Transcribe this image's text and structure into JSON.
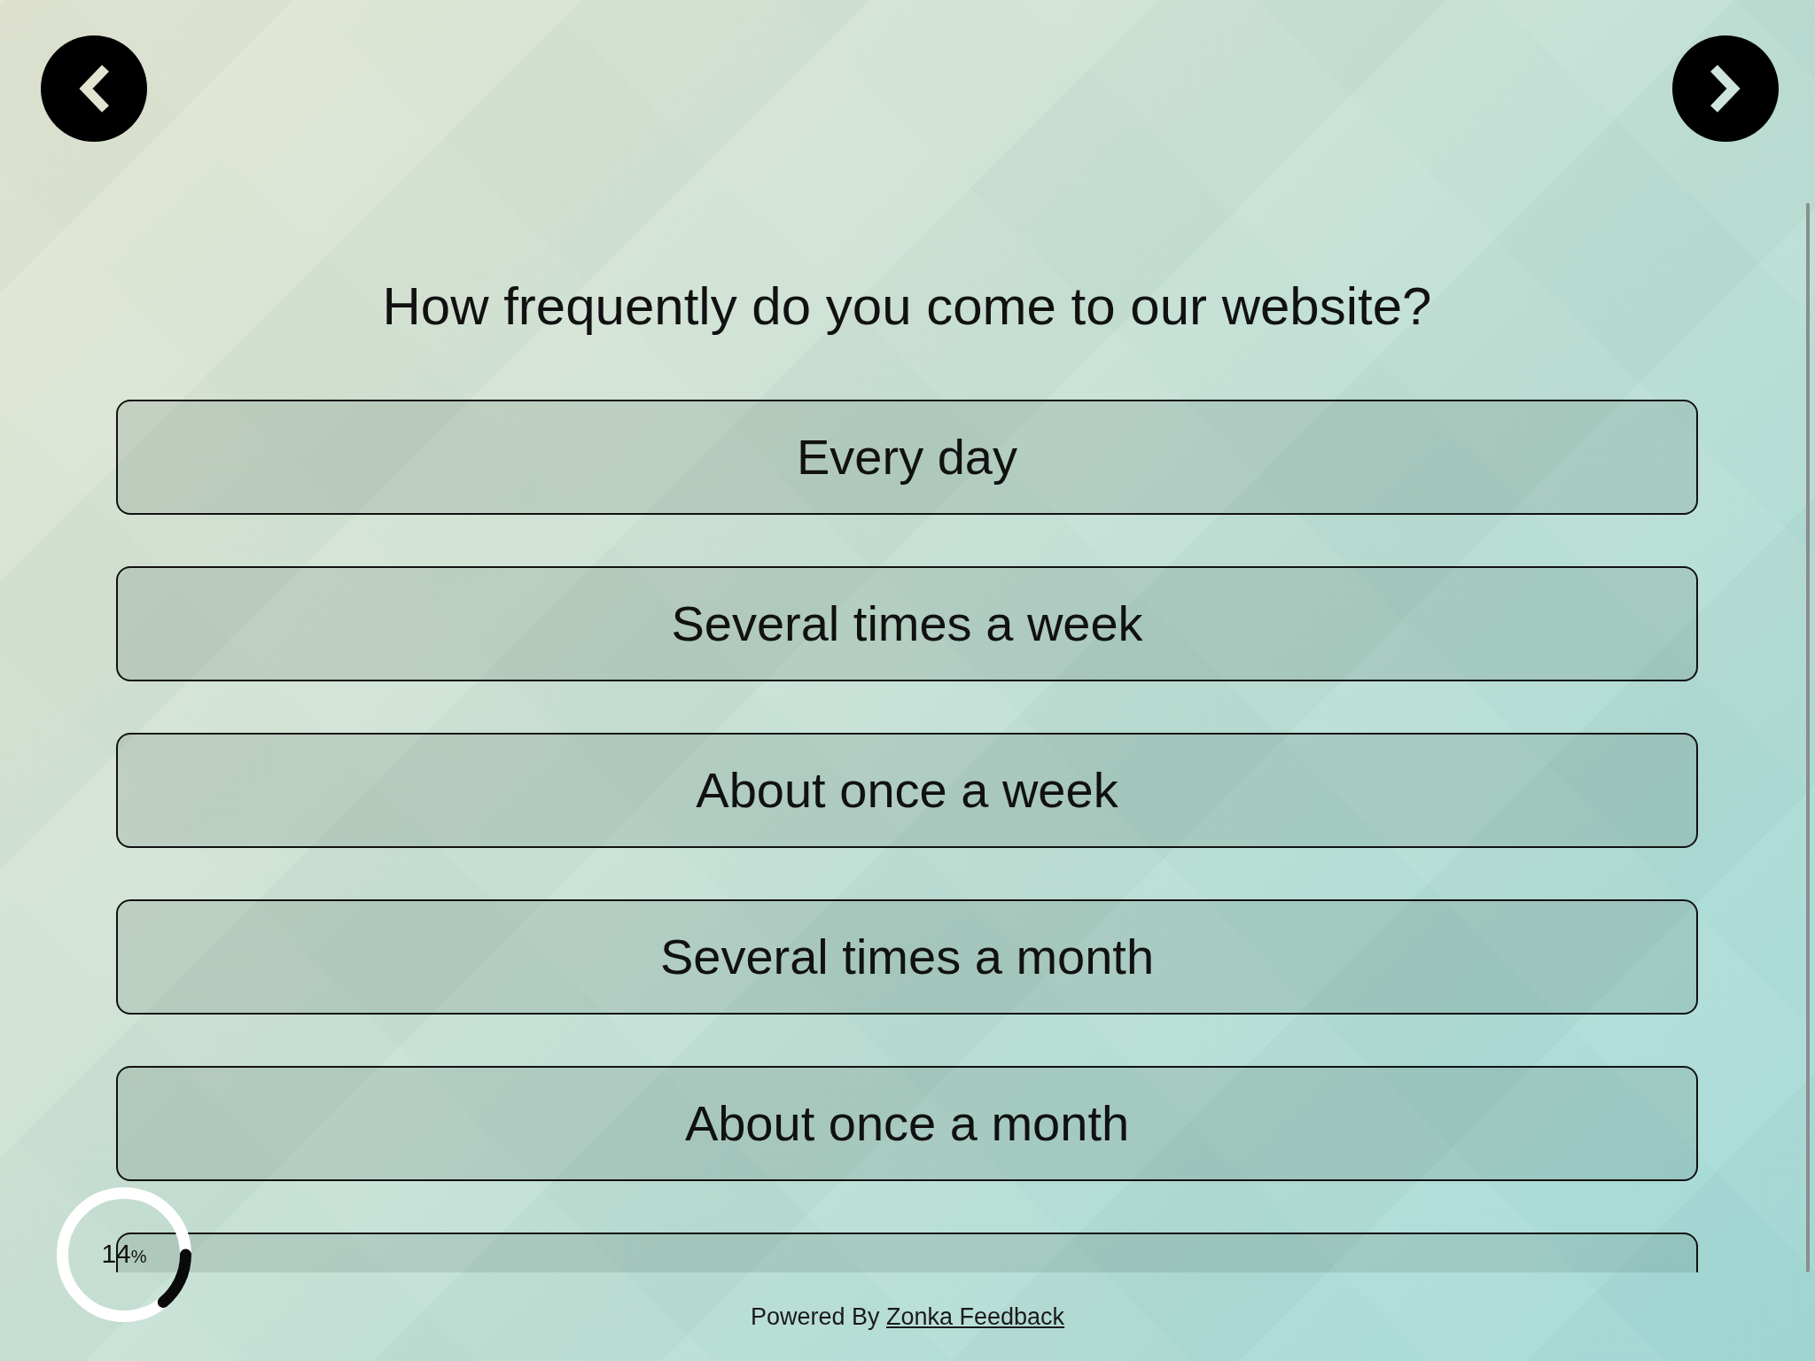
{
  "question": "How frequently do you come to our website?",
  "options": [
    {
      "label": "Every day",
      "selected": false
    },
    {
      "label": "Several times a week",
      "selected": false
    },
    {
      "label": "About once a week",
      "selected": false
    },
    {
      "label": "Several times a month",
      "selected": false
    },
    {
      "label": "About once a month",
      "selected": false
    }
  ],
  "cut_off_option": {
    "selected": false
  },
  "progress": {
    "value": "14",
    "unit": "%",
    "level": 0.14
  },
  "footer": {
    "text": "Powered By",
    "link": "Zonka Feedback"
  }
}
